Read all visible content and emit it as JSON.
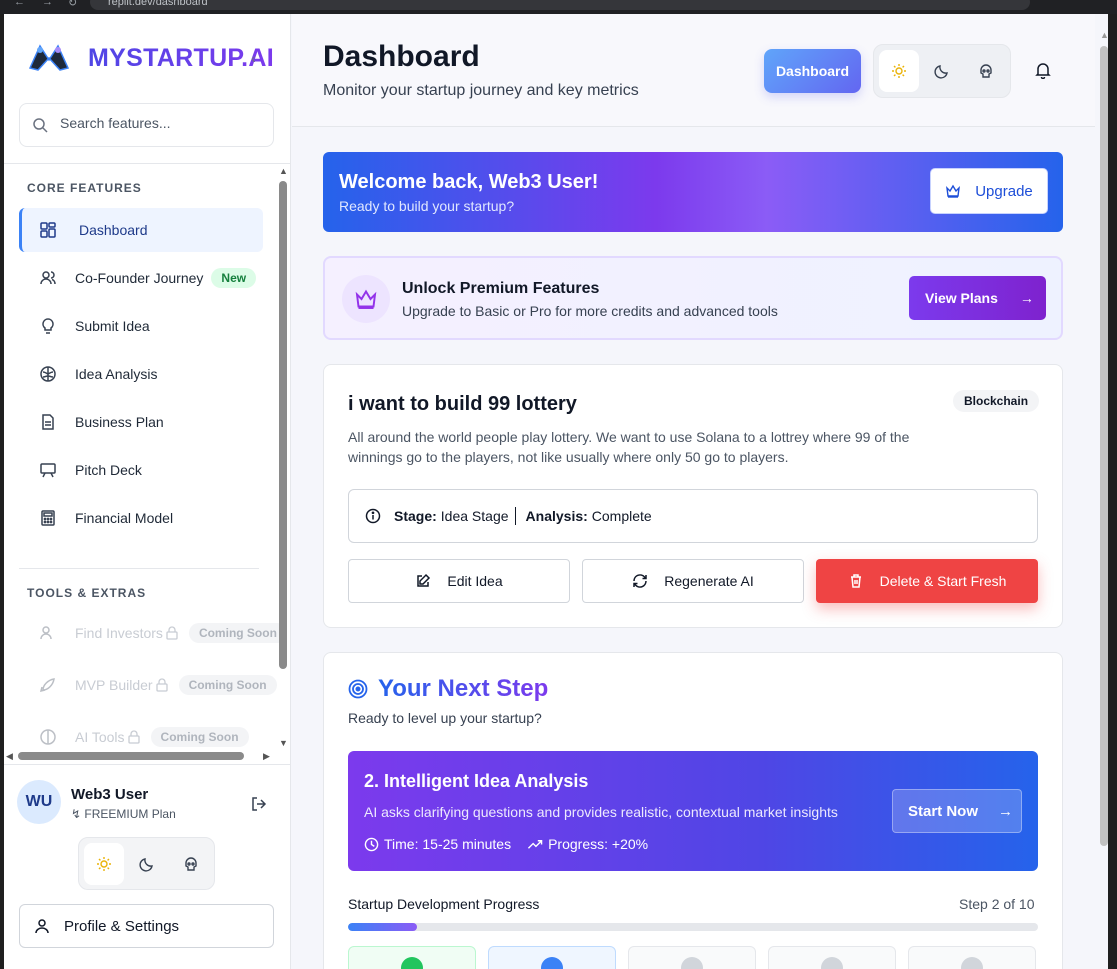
{
  "browser": {
    "url": "replit.dev/dashboard"
  },
  "sidebar": {
    "brand": "MYSTARTUP.AI",
    "search_placeholder": "Search features...",
    "core_heading": "CORE FEATURES",
    "items": [
      {
        "label": "Dashboard",
        "icon": "grid-icon",
        "active": true
      },
      {
        "label": "Co-Founder Journey",
        "icon": "users-icon",
        "badge": "New"
      },
      {
        "label": "Submit Idea",
        "icon": "lightbulb-icon"
      },
      {
        "label": "Idea Analysis",
        "icon": "brain-icon"
      },
      {
        "label": "Business Plan",
        "icon": "document-icon"
      },
      {
        "label": "Pitch Deck",
        "icon": "presentation-icon"
      },
      {
        "label": "Financial Model",
        "icon": "calculator-icon"
      }
    ],
    "tools_heading": "TOOLS & EXTRAS",
    "tools": [
      {
        "label": "Find Investors",
        "icon": "users-icon",
        "badge": "Coming Soon"
      },
      {
        "label": "MVP Builder",
        "icon": "rocket-icon",
        "badge": "Coming Soon"
      },
      {
        "label": "AI Tools",
        "icon": "brain-icon",
        "badge": "Coming Soon"
      }
    ],
    "user": {
      "initials": "WU",
      "name": "Web3 User",
      "plan": "FREEMIUM Plan"
    },
    "profile_label": "Profile & Settings"
  },
  "header": {
    "title": "Dashboard",
    "subtitle": "Monitor your startup journey and key metrics",
    "dashboard_button": "Dashboard"
  },
  "welcome": {
    "title": "Welcome back, Web3 User!",
    "subtitle": "Ready to build your startup?",
    "upgrade_label": "Upgrade"
  },
  "premium": {
    "title": "Unlock Premium Features",
    "subtitle": "Upgrade to Basic or Pro for more credits and advanced tools",
    "button": "View Plans"
  },
  "idea": {
    "title": "i want to build 99 lottery",
    "category": "Blockchain",
    "description": "All around the world people play lottery. We want to use Solana to a lottrey where 99 of the winnings go to the players, not like usually where only 50 go to players.",
    "stage_label": "Stage:",
    "stage_value": "Idea Stage",
    "analysis_label": "Analysis:",
    "analysis_value": "Complete",
    "edit_label": "Edit Idea",
    "regen_label": "Regenerate AI",
    "delete_label": "Delete & Start Fresh"
  },
  "next_step": {
    "title": "Your Next Step",
    "subtitle": "Ready to level up your startup?",
    "step_title": "2. Intelligent Idea Analysis",
    "step_desc": "AI asks clarifying questions and provides realistic, contextual market insights",
    "time": "Time: 15-25 minutes",
    "progress": "Progress: +20%",
    "start_label": "Start Now",
    "progress_label": "Startup Development Progress",
    "step_count": "Step 2 of 10",
    "progress_fraction": 0.1
  },
  "colors": {
    "accent": "#3b82f6",
    "purple": "#7c3aed",
    "danger": "#ef4444",
    "new_badge": "#15803d"
  }
}
